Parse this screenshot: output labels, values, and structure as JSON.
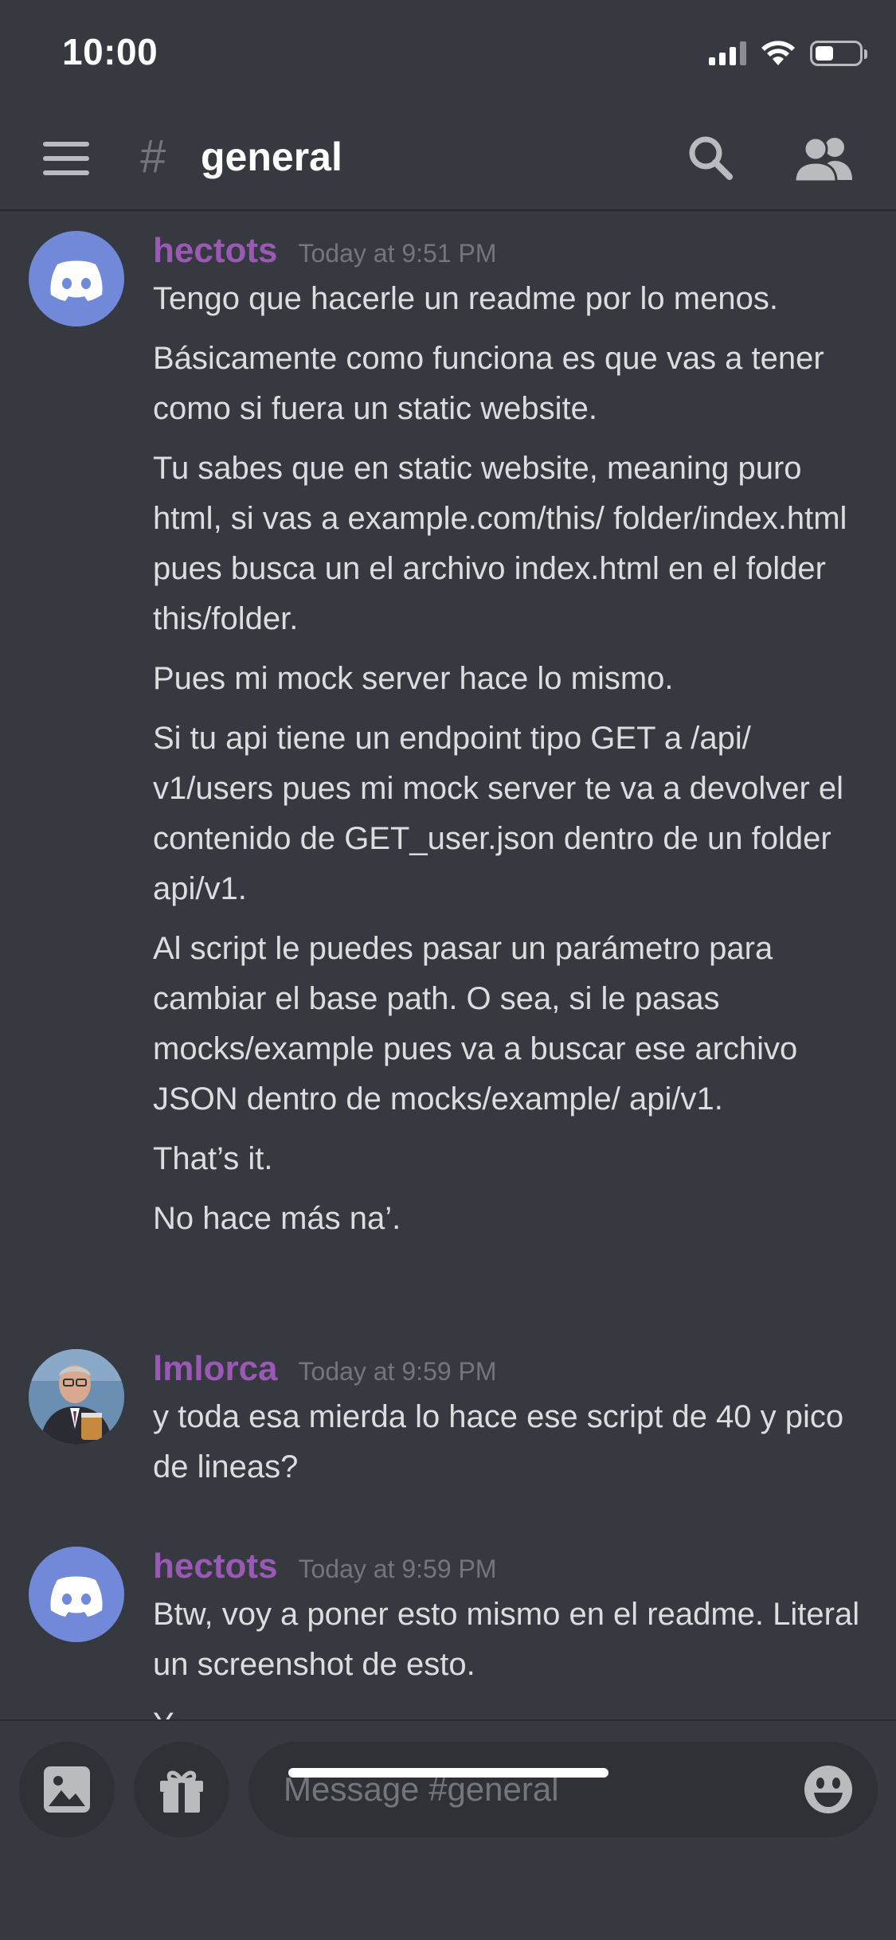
{
  "status_bar": {
    "time": "10:00"
  },
  "header": {
    "hash": "#",
    "channel": "general"
  },
  "messages": [
    {
      "username": "hectots",
      "timestamp": "Today at 9:51 PM",
      "avatar": "discord-logo-icon",
      "lines": [
        "Tengo que hacerle un readme por lo menos.",
        "Básicamente como funciona es que vas a tener como si fuera un static website.",
        "Tu sabes que en static website, meaning puro html, si vas a example.com/this/ folder/index.html pues busca un el archivo index.html en el folder this/folder.",
        "Pues mi mock server hace lo mismo.",
        "Si tu api tiene un endpoint tipo GET a /api/ v1/users pues mi mock server te va a devolver el contenido de GET_user.json dentro de un folder api/v1.",
        "Al script le puedes pasar un parámetro para cambiar el base path. O sea, si le pasas mocks/example pues va a buscar ese archivo JSON dentro de mocks/example/ api/v1.",
        "That’s it.",
        "No hace más na’."
      ]
    },
    {
      "username": "lmlorca",
      "timestamp": "Today at 9:59 PM",
      "avatar": "user-photo-avatar",
      "lines": [
        "y toda esa mierda lo hace ese script de 40 y pico de lineas?"
      ]
    },
    {
      "username": "hectots",
      "timestamp": "Today at 9:59 PM",
      "avatar": "discord-logo-icon",
      "lines": [
        "Btw, voy a poner esto mismo en el readme. Literal un screenshot de esto.",
        "Y"
      ]
    }
  ],
  "composer": {
    "placeholder": "Message #general"
  },
  "colors": {
    "background": "#36393f",
    "username": "#9b59b6",
    "discord_blurple": "#7289da",
    "input_background": "#2f3136"
  }
}
